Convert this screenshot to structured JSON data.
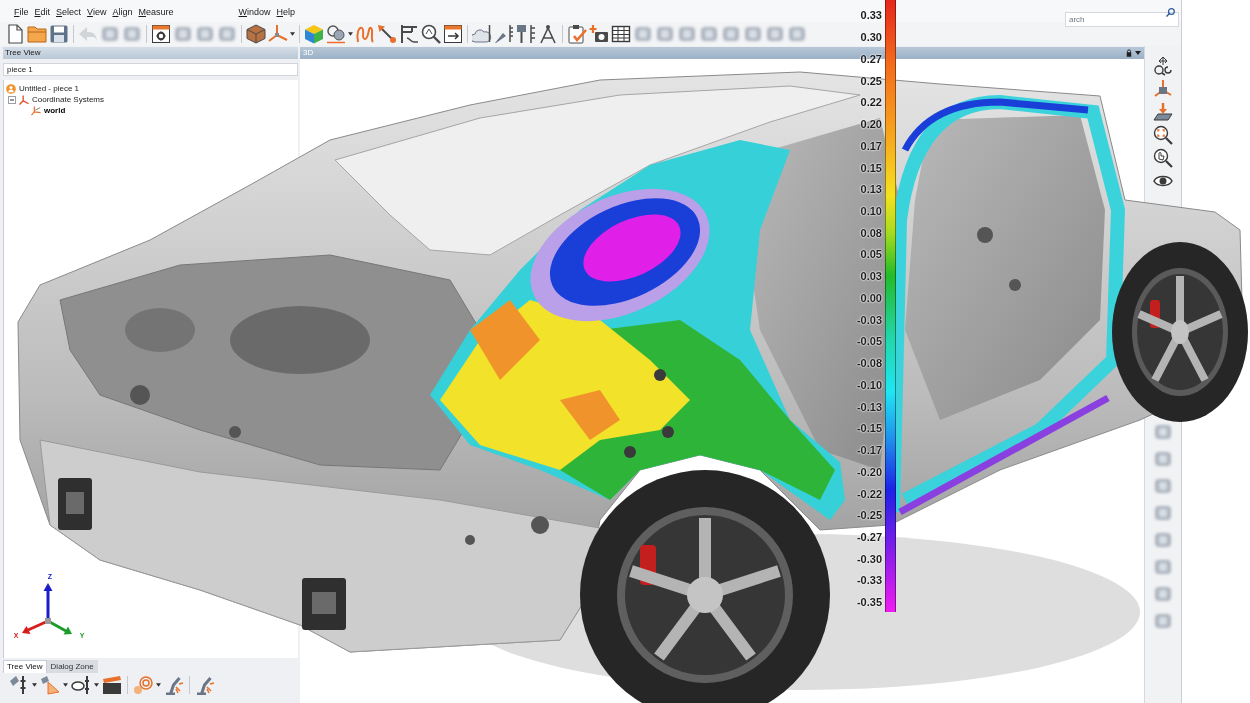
{
  "menu_bar": {
    "items": [
      "File",
      "Edit",
      "Select",
      "View",
      "Align",
      "Measure",
      "Window",
      "Help"
    ]
  },
  "search": {
    "placeholder": "arch"
  },
  "tree_panel": {
    "title": "Tree View",
    "filter": {
      "value": "piece 1"
    },
    "tree": [
      {
        "label": "Untitled - piece 1",
        "kind": "project",
        "children": [
          {
            "label": "Coordinate Systems",
            "kind": "folder",
            "expanded": true,
            "children": [
              {
                "label": "world",
                "kind": "axes",
                "active": true
              }
            ]
          }
        ]
      }
    ]
  },
  "bottom_tabs": [
    {
      "label": "Tree View",
      "selected": true
    },
    {
      "label": "Dialog Zone",
      "selected": false
    }
  ],
  "viewport": {
    "title": "3D",
    "axis_labels": {
      "x": "X",
      "y": "Y",
      "z": "Z"
    }
  },
  "color_scale": {
    "labels": [
      "0.33",
      "0.30",
      "0.27",
      "0.25",
      "0.22",
      "0.20",
      "0.17",
      "0.15",
      "0.13",
      "0.10",
      "0.08",
      "0.05",
      "0.03",
      "0.00",
      "-0.03",
      "-0.05",
      "-0.08",
      "-0.10",
      "-0.13",
      "-0.15",
      "-0.17",
      "-0.20",
      "-0.22",
      "-0.25",
      "-0.27",
      "-0.30",
      "-0.33",
      "-0.35"
    ]
  }
}
